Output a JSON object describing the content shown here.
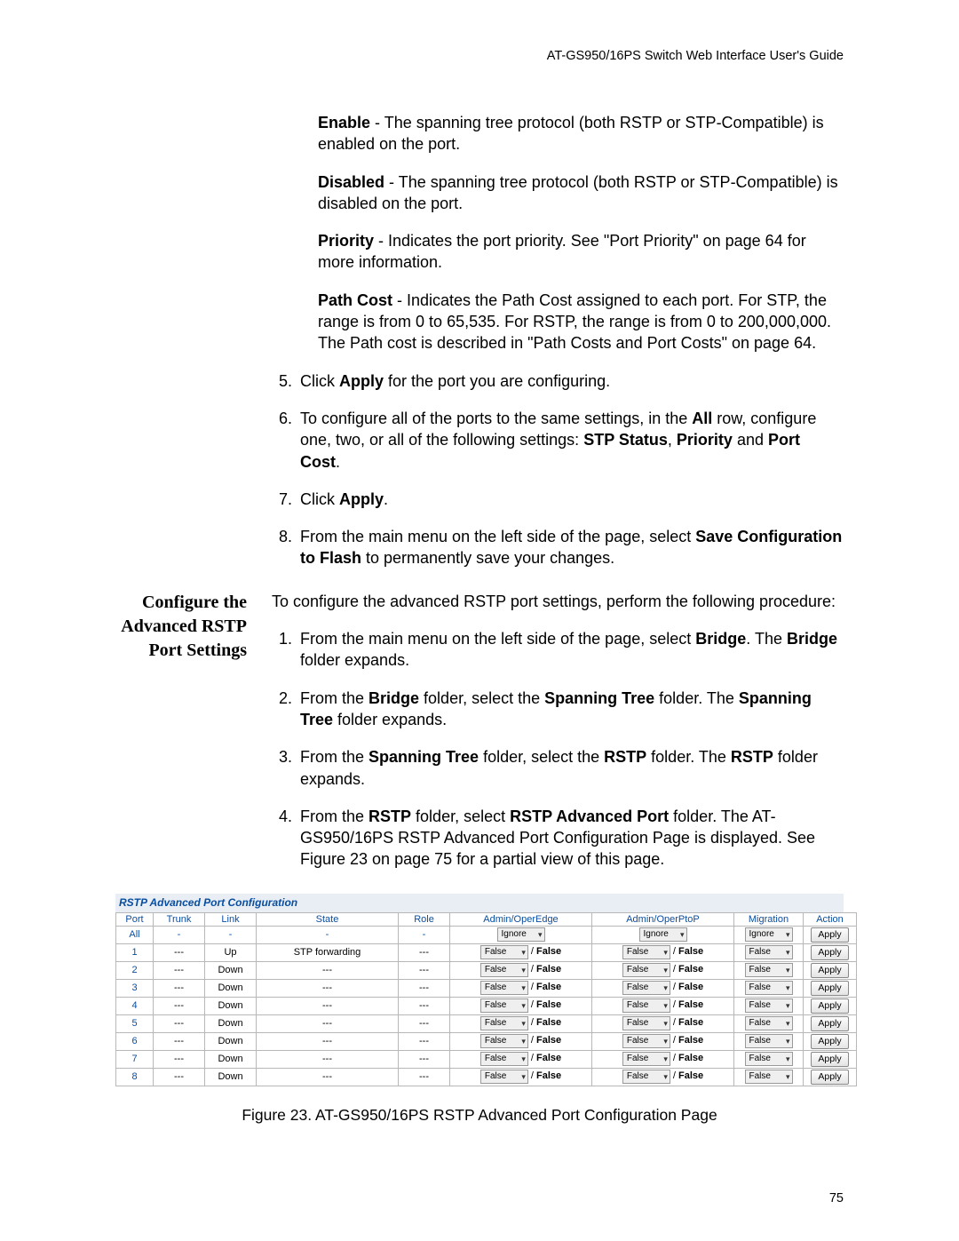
{
  "header": "AT-GS950/16PS Switch Web Interface User's Guide",
  "pageNum": "75",
  "enable_def": " - The spanning tree protocol (both RSTP or STP-Compatible) is enabled on the port.",
  "disabled_def": " - The spanning tree protocol (both RSTP or STP-Compatible) is disabled on the port.",
  "priority_def": " - Indicates the port priority. See \"Port Priority\" on page 64 for more information.",
  "pathcost_def": " - Indicates the Path Cost assigned to each port. For STP, the range is from 0 to 65,535. For RSTP, the range is from 0 to 200,000,000. The Path cost is described in \"Path Costs and Port Costs\" on page 64.",
  "step5_a": "Click ",
  "step5_b": " for the port you are configuring.",
  "step6_a": "To configure all of the ports to the same settings, in the ",
  "step6_b": " row, configure one, two, or all of the following settings: ",
  "step6_c": " and ",
  "step7_a": "Click ",
  "step7_b": ".",
  "step8_a": "From the main menu on the left side of the page, select ",
  "step8_b": " to permanently save your changes.",
  "section_heading_l1": "Configure the",
  "section_heading_l2": "Advanced RSTP",
  "section_heading_l3": "Port Settings",
  "sec_intro": "To configure the advanced RSTP port settings, perform the following procedure:",
  "s1_a": "From the main menu on the left side of the page, select ",
  "s1_b": ". The ",
  "s1_c": " folder expands.",
  "s2_a": "From the ",
  "s2_b": " folder, select the ",
  "s2_c": " folder. The ",
  "s2_d": " folder expands.",
  "s3_a": "From the ",
  "s3_b": " folder, select the ",
  "s3_c": " folder. The ",
  "s3_d": " folder expands.",
  "s4_a": "From the ",
  "s4_b": " folder, select ",
  "s4_c": " folder. The AT-GS950/16PS RSTP Advanced Port Configuration Page is displayed. See Figure 23 on page 75 for a partial view of this page.",
  "bold": {
    "enable": "Enable",
    "disabled": "Disabled",
    "priority": "Priority",
    "pathcost": "Path Cost",
    "apply": "Apply",
    "all": "All",
    "stpstatus": "STP Status",
    "prio2": "Priority",
    "portcost": "Port Cost",
    "save": "Save Configuration to Flash",
    "bridge": "Bridge",
    "spanning": "Spanning Tree",
    "rstp": "RSTP",
    "rstpadv": "RSTP Advanced Port"
  },
  "fig_title": "RSTP Advanced Port Configuration",
  "table": {
    "headers": [
      "Port",
      "Trunk",
      "Link",
      "State",
      "Role",
      "Admin/OperEdge",
      "Admin/OperPtoP",
      "Migration",
      "Action"
    ],
    "all_row": {
      "port": "All",
      "trunk": "-",
      "link": "-",
      "state": "-",
      "role": "-",
      "edge_sel": "Ignore",
      "ptop_sel": "Ignore",
      "mig_sel": "Ignore",
      "action": "Apply"
    },
    "rows": [
      {
        "port": "1",
        "trunk": "---",
        "link": "Up",
        "state": "STP forwarding",
        "role": "---",
        "edge_sel": "False",
        "edge_val": "False",
        "ptop_sel": "False",
        "ptop_val": "False",
        "mig_sel": "False",
        "action": "Apply"
      },
      {
        "port": "2",
        "trunk": "---",
        "link": "Down",
        "state": "---",
        "role": "---",
        "edge_sel": "False",
        "edge_val": "False",
        "ptop_sel": "False",
        "ptop_val": "False",
        "mig_sel": "False",
        "action": "Apply"
      },
      {
        "port": "3",
        "trunk": "---",
        "link": "Down",
        "state": "---",
        "role": "---",
        "edge_sel": "False",
        "edge_val": "False",
        "ptop_sel": "False",
        "ptop_val": "False",
        "mig_sel": "False",
        "action": "Apply"
      },
      {
        "port": "4",
        "trunk": "---",
        "link": "Down",
        "state": "---",
        "role": "---",
        "edge_sel": "False",
        "edge_val": "False",
        "ptop_sel": "False",
        "ptop_val": "False",
        "mig_sel": "False",
        "action": "Apply"
      },
      {
        "port": "5",
        "trunk": "---",
        "link": "Down",
        "state": "---",
        "role": "---",
        "edge_sel": "False",
        "edge_val": "False",
        "ptop_sel": "False",
        "ptop_val": "False",
        "mig_sel": "False",
        "action": "Apply"
      },
      {
        "port": "6",
        "trunk": "---",
        "link": "Down",
        "state": "---",
        "role": "---",
        "edge_sel": "False",
        "edge_val": "False",
        "ptop_sel": "False",
        "ptop_val": "False",
        "mig_sel": "False",
        "action": "Apply"
      },
      {
        "port": "7",
        "trunk": "---",
        "link": "Down",
        "state": "---",
        "role": "---",
        "edge_sel": "False",
        "edge_val": "False",
        "ptop_sel": "False",
        "ptop_val": "False",
        "mig_sel": "False",
        "action": "Apply"
      },
      {
        "port": "8",
        "trunk": "---",
        "link": "Down",
        "state": "---",
        "role": "---",
        "edge_sel": "False",
        "edge_val": "False",
        "ptop_sel": "False",
        "ptop_val": "False",
        "mig_sel": "False",
        "action": "Apply"
      }
    ]
  },
  "caption": "Figure 23. AT-GS950/16PS RSTP Advanced Port Configuration Page"
}
